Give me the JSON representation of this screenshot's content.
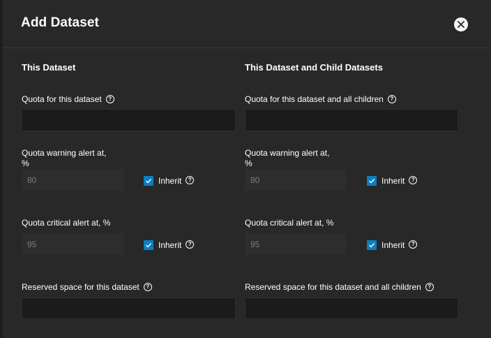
{
  "dialog": {
    "title": "Add Dataset",
    "close_icon": "close-icon"
  },
  "left": {
    "section_title": "This Dataset",
    "quota_label": "Quota for this dataset",
    "quota_value": "",
    "warning_label_1": "Quota warning alert at,",
    "warning_label_2": "%",
    "warning_value": "80",
    "warning_inherit": "Inherit",
    "warning_inherit_checked": true,
    "critical_label": "Quota critical alert at, %",
    "critical_value": "95",
    "critical_inherit": "Inherit",
    "critical_inherit_checked": true,
    "reserved_label": "Reserved space for this dataset",
    "reserved_value": ""
  },
  "right": {
    "section_title": "This Dataset and Child Datasets",
    "quota_label": "Quota for this dataset and all children",
    "quota_value": "",
    "warning_label_1": "Quota warning alert at,",
    "warning_label_2": "%",
    "warning_value": "80",
    "warning_inherit": "Inherit",
    "warning_inherit_checked": true,
    "critical_label": "Quota critical alert at, %",
    "critical_value": "95",
    "critical_inherit": "Inherit",
    "critical_inherit_checked": true,
    "reserved_label": "Reserved space for this dataset and all children",
    "reserved_value": ""
  },
  "colors": {
    "background": "#282828",
    "input": "#1d1d1d",
    "disabled_input": "#2d2d2d",
    "accent": "#0d7fbf"
  }
}
